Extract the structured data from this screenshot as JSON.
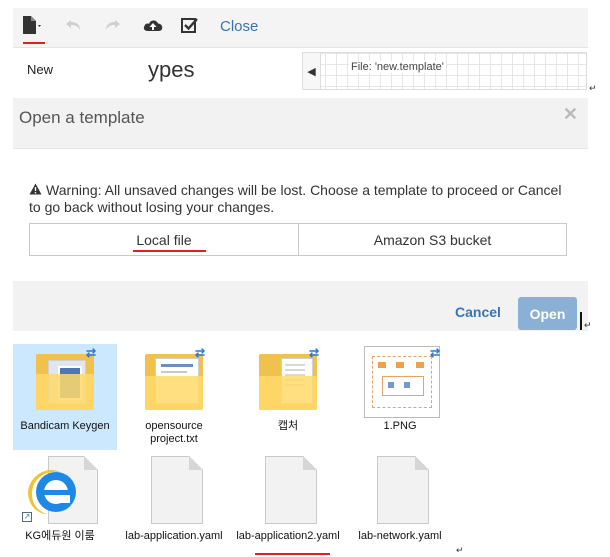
{
  "toolbar": {
    "icons": [
      "new-file-icon",
      "undo-icon",
      "redo-icon",
      "cloud-upload-icon",
      "validate-icon"
    ],
    "close_label": "Close"
  },
  "menu": {
    "new_label": "New",
    "types_fragment": "ypes",
    "file_label": "File: 'new.template'"
  },
  "dialog": {
    "title": "Open a template",
    "warning": "Warning: All unsaved changes will be lost. Choose a template to proceed or Cancel to go back without losing your changes.",
    "local_file_label": "Local file",
    "s3_label": "Amazon S3 bucket",
    "cancel_label": "Cancel",
    "open_label": "Open"
  },
  "files": [
    {
      "label": "Bandicam Keygen",
      "icon": "folder-icon"
    },
    {
      "label": "opensource project.txt",
      "icon": "folder-icon"
    },
    {
      "label": "캡처",
      "icon": "folder-icon"
    },
    {
      "label": "1.PNG",
      "icon": "image-icon"
    },
    {
      "label": "KG에듀원 이룸",
      "icon": "internet-explorer-icon"
    },
    {
      "label": "lab-application.yaml",
      "icon": "document-icon"
    },
    {
      "label": "lab-application2.yaml",
      "icon": "document-icon"
    },
    {
      "label": "lab-network.yaml",
      "icon": "document-icon"
    }
  ],
  "colors": {
    "accent_blue": "#3a73b5",
    "open_button": "#8ab0d6",
    "underline_red": "#e02020",
    "selection": "#cce8ff"
  }
}
